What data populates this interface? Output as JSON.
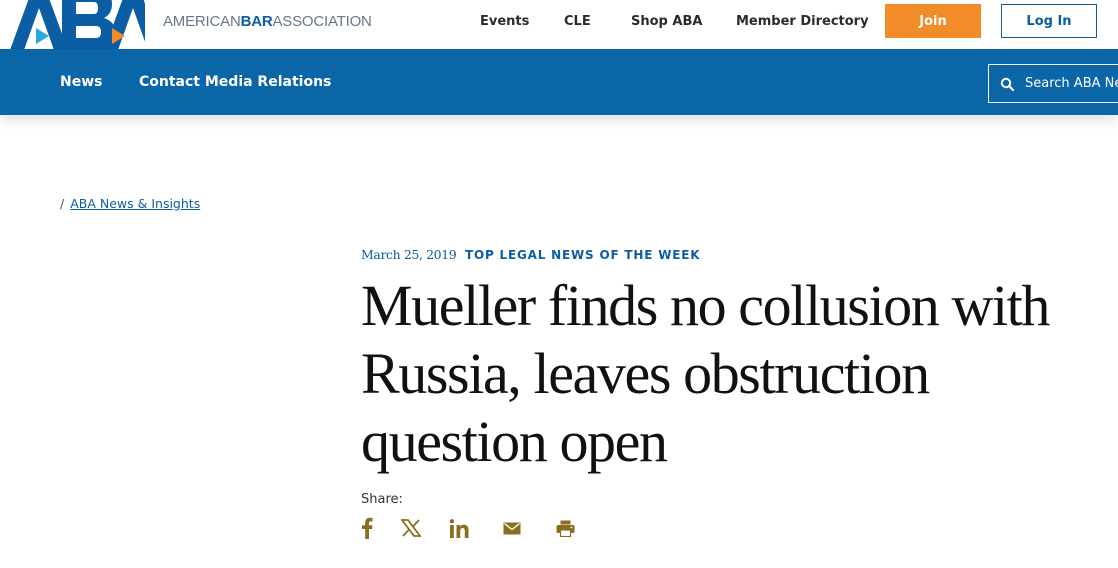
{
  "brand": {
    "logo_letters": "ABA",
    "name_prefix": "AMERICAN",
    "name_bold": "BAR",
    "name_suffix": "ASSOCIATION"
  },
  "top_nav": {
    "items": [
      "Events",
      "CLE",
      "Shop ABA",
      "Member Directory"
    ],
    "join_label": "Join",
    "login_label": "Log In"
  },
  "main_nav": {
    "items": [
      "News",
      "Contact Media Relations"
    ],
    "search_placeholder": "Search ABA News"
  },
  "breadcrumb": {
    "separator": "/",
    "link": "ABA News & Insights"
  },
  "article": {
    "date": "March 25, 2019",
    "category": "TOP LEGAL NEWS OF THE WEEK",
    "title": "Mueller finds no collusion with Russia, leaves obstruction question open"
  },
  "share": {
    "label": "Share:",
    "icons": [
      "facebook-icon",
      "x-icon",
      "linkedin-icon",
      "email-icon",
      "print-icon"
    ]
  },
  "colors": {
    "brand_blue": "#0b66a8",
    "link_blue": "#0b5ea3",
    "join_orange": "#f28c28",
    "share_gold": "#8a6d1e",
    "logo_cyan": "#29a8df"
  }
}
